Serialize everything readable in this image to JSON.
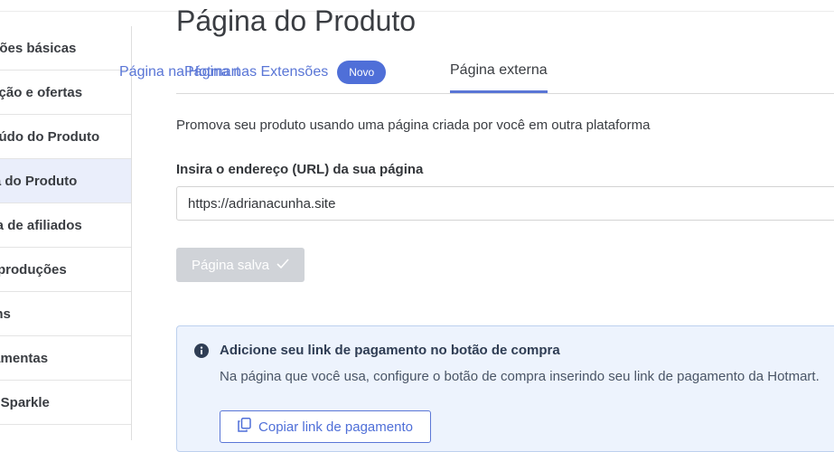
{
  "sidebar": {
    "items": [
      {
        "label": "Informações básicas",
        "active": false
      },
      {
        "label": "Precificação e ofertas",
        "active": false
      },
      {
        "label": "Conteúdo do Produto",
        "active": false
      },
      {
        "label": "Página do Produto",
        "active": true
      },
      {
        "label": "Programa de afiliados",
        "active": false
      },
      {
        "label": "Coproduções",
        "active": false
      },
      {
        "label": "Cupons",
        "active": false
      },
      {
        "label": "Ferramentas",
        "active": false
      },
      {
        "label": "Hotmart Sparkle",
        "active": false
      }
    ]
  },
  "main": {
    "title": "Página do Produto",
    "tabs": [
      {
        "label": "Página na Hotmart",
        "active": false
      },
      {
        "label": "Página nas Extensões",
        "badge": "Novo",
        "active": false
      },
      {
        "label": "Página externa",
        "active": true
      }
    ],
    "description": "Promova seu produto usando uma página criada por você em outra plataforma",
    "url_field": {
      "label": "Insira o endereço (URL) da sua página",
      "value": "https://adrianacunha.site"
    },
    "save_button": {
      "label": "Página salva",
      "icon": "check-icon"
    },
    "info_box": {
      "icon": "info-circle-icon",
      "title": "Adicione seu link de pagamento no botão de compra",
      "text": "Na página que você usa, configure o botão de compra inserindo seu link de pagamento da Hotmart.",
      "copy_button": {
        "label": "Copiar link de pagamento",
        "icon": "copy-icon"
      }
    }
  },
  "colors": {
    "accent": "#5a76d6",
    "badge": "#4f6fd8",
    "active_sidebar": "#eaeefb",
    "disabled_button": "#d0d3d8",
    "info_bg": "#edf3fd"
  }
}
